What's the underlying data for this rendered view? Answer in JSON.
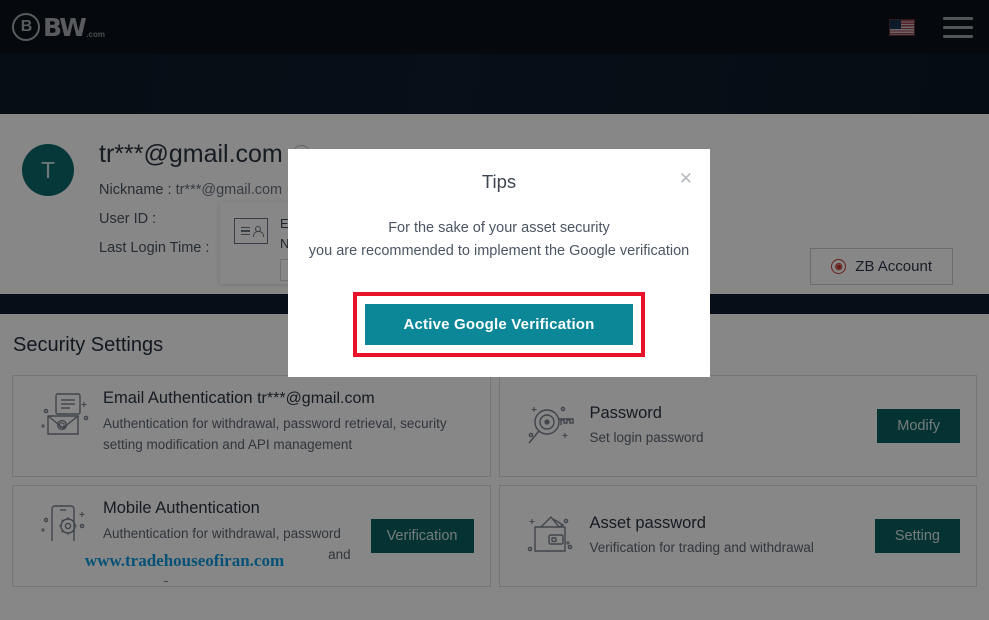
{
  "nav": {
    "logo_mark": "B",
    "logo_text": "BW",
    "logo_suffix": ".com",
    "flag_icon": "us-flag-icon",
    "menu_icon": "hamburger-menu-icon"
  },
  "account": {
    "avatar_initial": "T",
    "email": "tr***@gmail.com",
    "nickname_label": "Nickname :",
    "nickname_value": "tr***@gmail.com",
    "userid_label": "User ID :",
    "userid_value": "",
    "lastlogin_label": "Last Login Time :",
    "lastlogin_value": "",
    "zb_button": "ZB Account",
    "zb_icon": "zb-logo-icon"
  },
  "peek_card": {
    "icon": "id-card-icon",
    "line1": "E",
    "line2": "N"
  },
  "security": {
    "title": "Security Settings",
    "cards": [
      {
        "icon": "email-envelope-icon",
        "title": "Email Authentication",
        "title_extra": "tr***@gmail.com",
        "desc": "Authentication for withdrawal, password retrieval, security setting modification and API management",
        "button": ""
      },
      {
        "icon": "key-password-icon",
        "title": "Password",
        "title_extra": "",
        "desc": "Set login password",
        "button": "Modify"
      },
      {
        "icon": "mobile-phone-icon",
        "title": "Mobile Authentication",
        "title_extra": "",
        "desc": "Authentication for withdrawal, password retrieval, security setting modification and API management",
        "button": "Verification"
      },
      {
        "icon": "wallet-icon",
        "title": "Asset password",
        "title_extra": "",
        "desc": "Verification for trading and withdrawal",
        "button": "Setting"
      }
    ]
  },
  "watermark": {
    "text": "www.tradehouseofiran.com"
  },
  "modal": {
    "title": "Tips",
    "close_icon": "close-icon",
    "line1": "For the sake of your asset security",
    "line2": "you are recommended to implement the Google verification",
    "cta": "Active Google Verification"
  },
  "colors": {
    "nav_bg": "#0b1119",
    "hero_bg": "#101d2e",
    "accent_teal": "#0b5f5f",
    "cta_teal": "#0b8798",
    "highlight_red": "#e8122a",
    "avatar_teal": "#0d6a6e",
    "watermark_blue": "#0d9ae0"
  }
}
